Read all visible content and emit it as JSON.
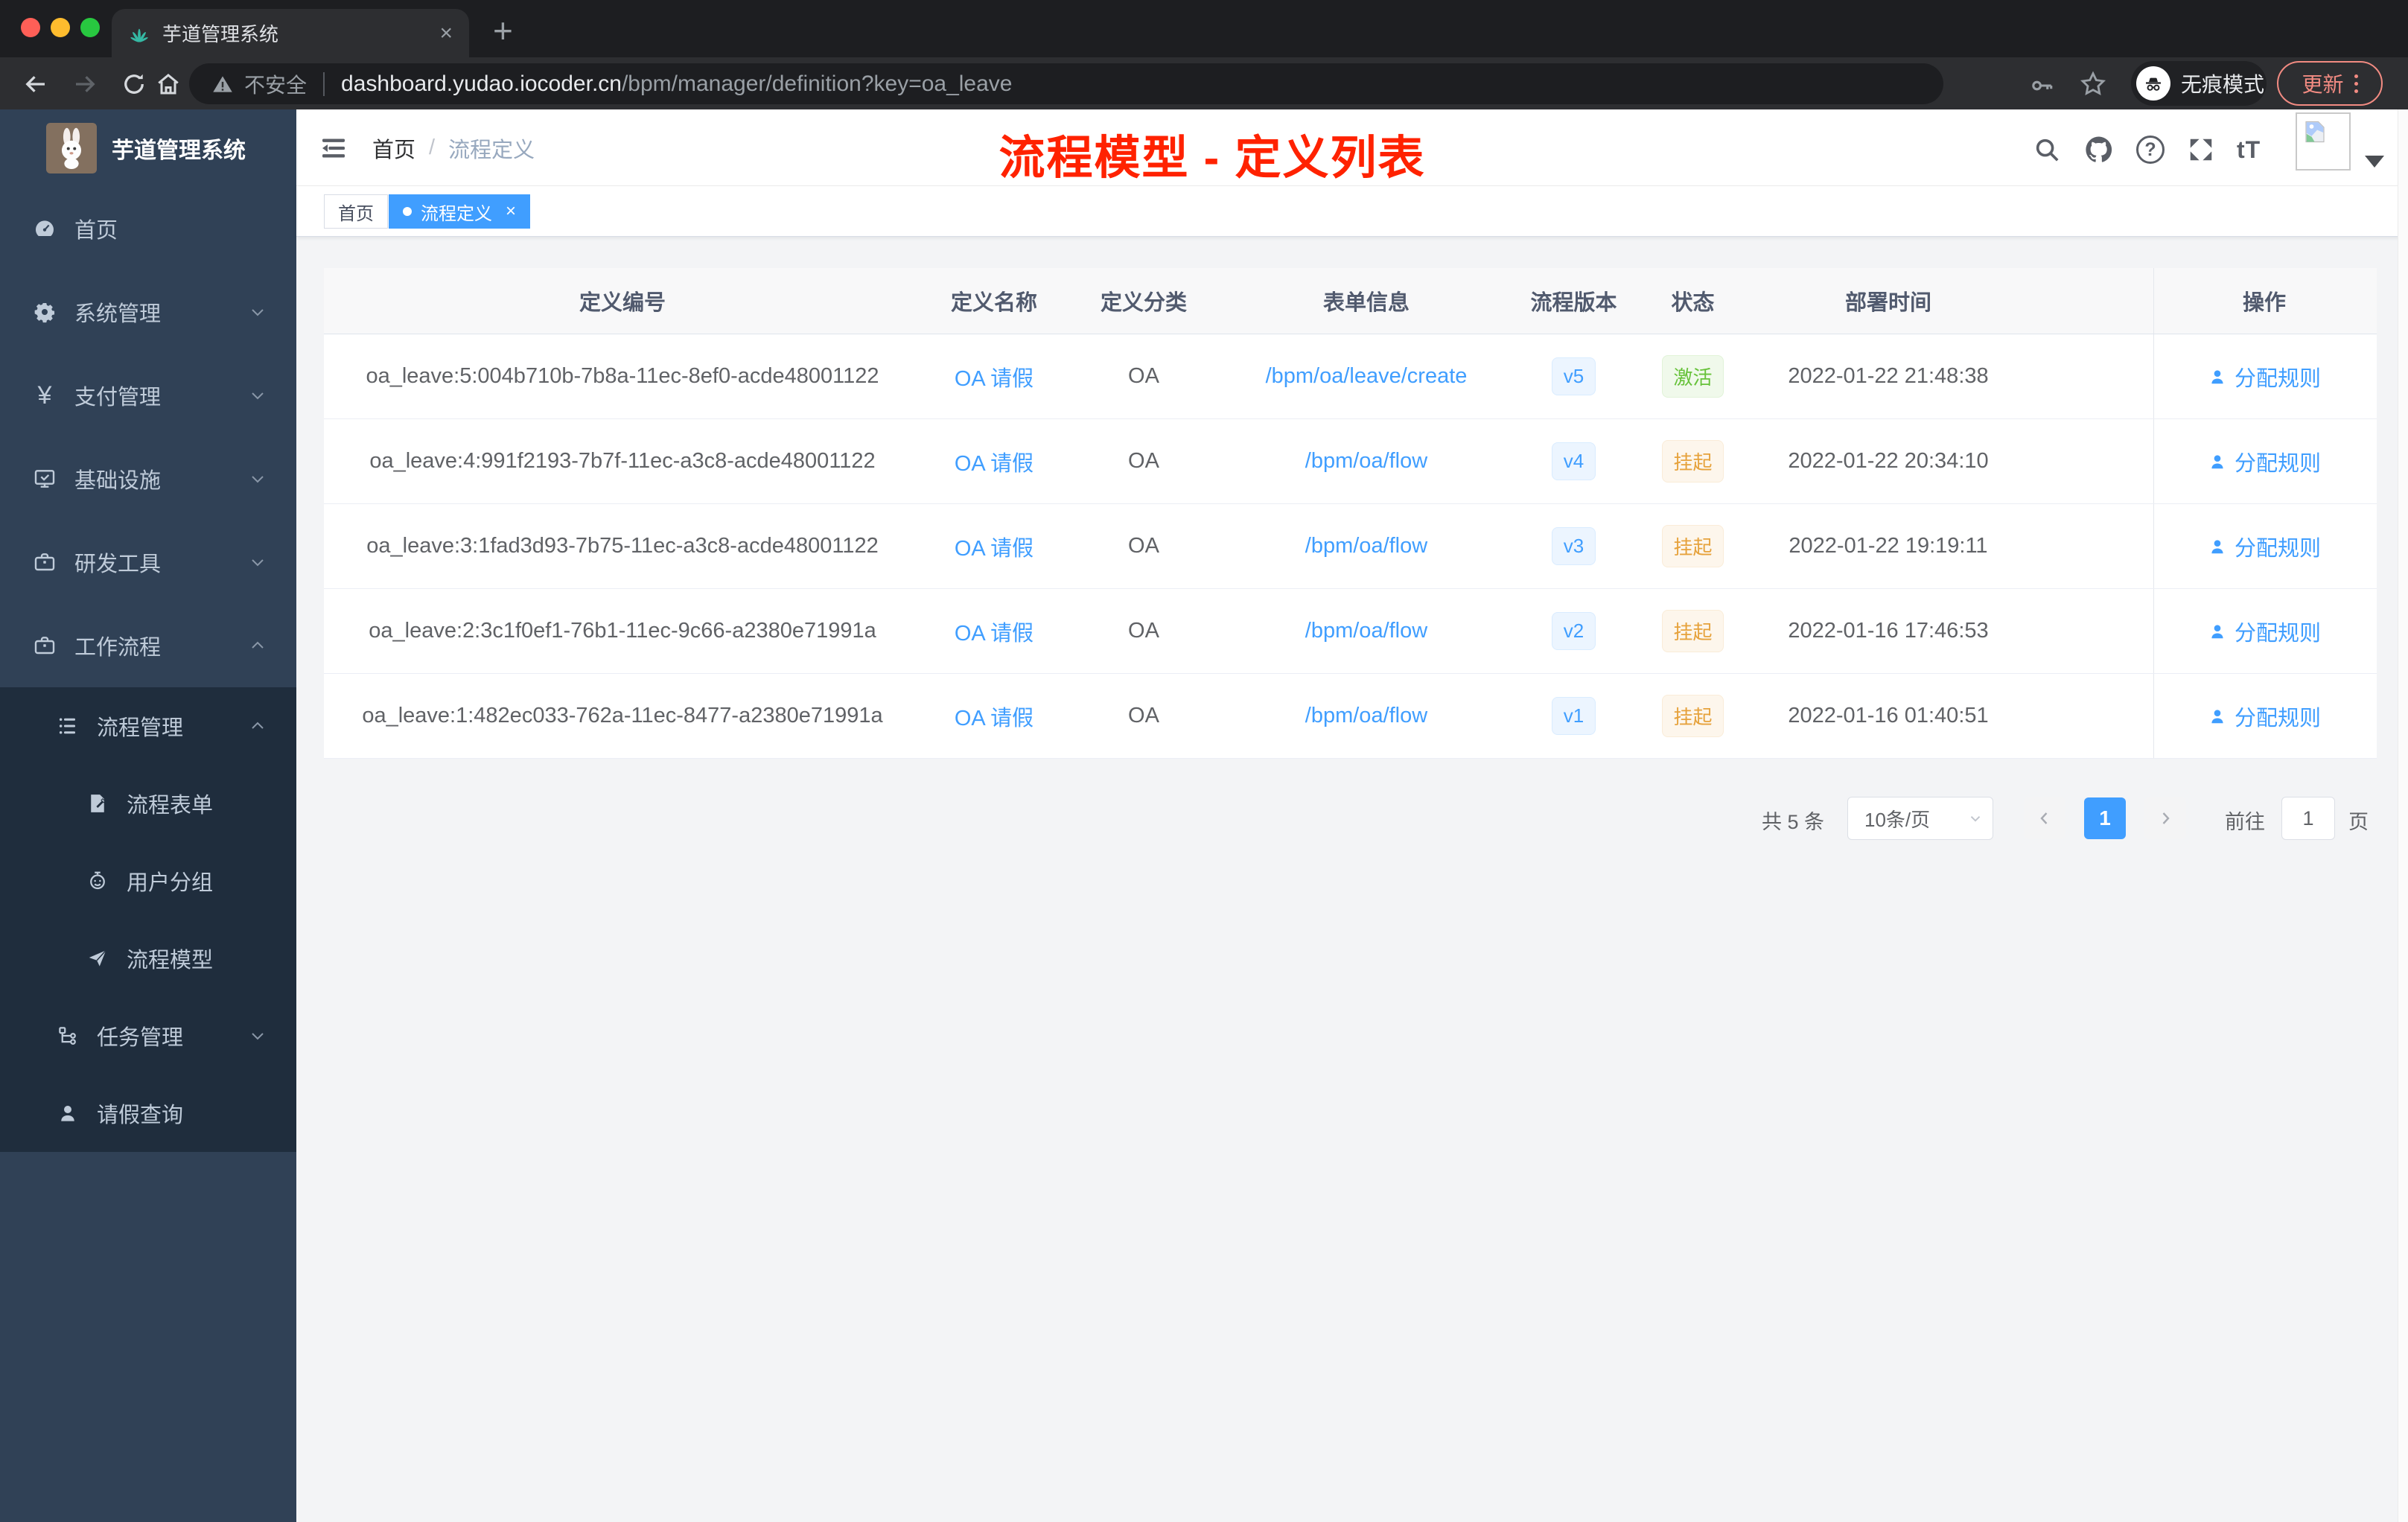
{
  "browser": {
    "tab_title": "芋道管理系统",
    "close_glyph": "×",
    "new_tab_glyph": "+",
    "security_label": "不安全",
    "url_domain": "dashboard.yudao.iocoder.cn",
    "url_path": "/bpm/manager/definition?key=oa_leave",
    "incognito_label": "无痕模式",
    "update_label": "更新"
  },
  "sidebar": {
    "app_title": "芋道管理系统",
    "menu": [
      {
        "label": "首页",
        "icon": "dashboard-icon",
        "chevron": ""
      },
      {
        "label": "系统管理",
        "icon": "gear-icon",
        "chevron": "down"
      },
      {
        "label": "支付管理",
        "icon": "yen-icon",
        "chevron": "down",
        "glyph": "¥"
      },
      {
        "label": "基础设施",
        "icon": "monitor-icon",
        "chevron": "down"
      },
      {
        "label": "研发工具",
        "icon": "briefcase-icon",
        "chevron": "down"
      },
      {
        "label": "工作流程",
        "icon": "briefcase-icon",
        "chevron": "up"
      }
    ],
    "submenu": [
      {
        "label": "流程管理",
        "icon": "list-icon",
        "chevron": "up"
      },
      {
        "label": "流程表单",
        "icon": "form-icon"
      },
      {
        "label": "用户分组",
        "icon": "robot-icon"
      },
      {
        "label": "流程模型",
        "icon": "paper-plane-icon"
      },
      {
        "label": "任务管理",
        "icon": "tree-icon",
        "chevron": "down"
      },
      {
        "label": "请假查询",
        "icon": "user-icon"
      }
    ]
  },
  "header": {
    "breadcrumb_home": "首页",
    "breadcrumb_sep": "/",
    "breadcrumb_current": "流程定义",
    "annotation": "流程模型 - 定义列表",
    "question_glyph": "?",
    "fontsize_glyph": "tT"
  },
  "tags": {
    "home": "首页",
    "active": "流程定义",
    "close_glyph": "×"
  },
  "table": {
    "columns": [
      "定义编号",
      "定义名称",
      "定义分类",
      "表单信息",
      "流程版本",
      "状态",
      "部署时间",
      "操作"
    ],
    "rows": [
      {
        "id": "oa_leave:5:004b710b-7b8a-11ec-8ef0-acde48001122",
        "name": "OA 请假",
        "category": "OA",
        "form": "/bpm/oa/leave/create",
        "version": "v5",
        "status": "激活",
        "status_type": "success",
        "time": "2022-01-22 21:48:38",
        "action": "分配规则"
      },
      {
        "id": "oa_leave:4:991f2193-7b7f-11ec-a3c8-acde48001122",
        "name": "OA 请假",
        "category": "OA",
        "form": "/bpm/oa/flow",
        "version": "v4",
        "status": "挂起",
        "status_type": "warning",
        "time": "2022-01-22 20:34:10",
        "action": "分配规则"
      },
      {
        "id": "oa_leave:3:1fad3d93-7b75-11ec-a3c8-acde48001122",
        "name": "OA 请假",
        "category": "OA",
        "form": "/bpm/oa/flow",
        "version": "v3",
        "status": "挂起",
        "status_type": "warning",
        "time": "2022-01-22 19:19:11",
        "action": "分配规则"
      },
      {
        "id": "oa_leave:2:3c1f0ef1-76b1-11ec-9c66-a2380e71991a",
        "name": "OA 请假",
        "category": "OA",
        "form": "/bpm/oa/flow",
        "version": "v2",
        "status": "挂起",
        "status_type": "warning",
        "time": "2022-01-16 17:46:53",
        "action": "分配规则"
      },
      {
        "id": "oa_leave:1:482ec033-762a-11ec-8477-a2380e71991a",
        "name": "OA 请假",
        "category": "OA",
        "form": "/bpm/oa/flow",
        "version": "v1",
        "status": "挂起",
        "status_type": "warning",
        "time": "2022-01-16 01:40:51",
        "action": "分配规则"
      }
    ]
  },
  "pagination": {
    "total": "共 5 条",
    "page_size": "10条/页",
    "page": "1",
    "goto_label": "前往",
    "goto_value": "1",
    "unit": "页"
  },
  "colors": {
    "accent": "#409eff",
    "annotation_red": "#ff2200",
    "success_green": "#67c23a",
    "warning_orange": "#e6a23c",
    "sidebar_bg": "#304156",
    "submenu_bg": "#1f2d3d"
  }
}
